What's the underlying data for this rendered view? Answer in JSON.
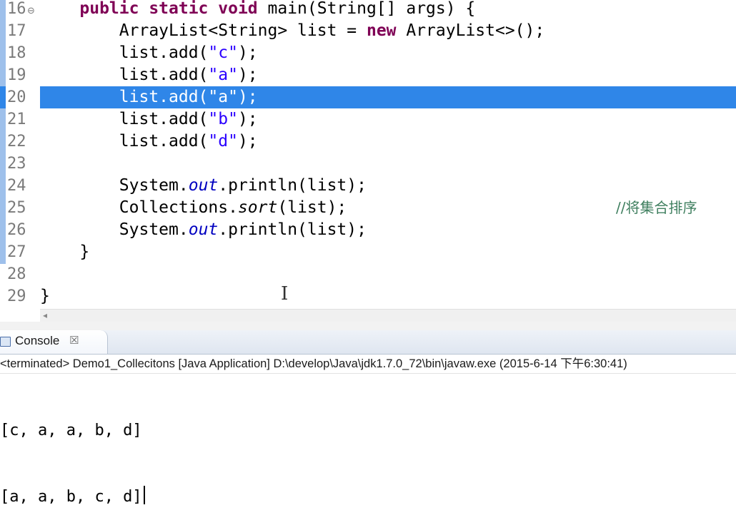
{
  "editor": {
    "lines": [
      {
        "num": "16",
        "fold": true,
        "parts": [
          [
            "",
            "    "
          ],
          [
            "kw",
            "public static void"
          ],
          [
            "",
            " main(String[] args) {"
          ]
        ]
      },
      {
        "num": "17",
        "parts": [
          [
            "",
            "        ArrayList<String> list = "
          ],
          [
            "kw",
            "new"
          ],
          [
            "",
            " ArrayList<>();"
          ]
        ]
      },
      {
        "num": "18",
        "parts": [
          [
            "",
            "        list.add("
          ],
          [
            "str",
            "\"c\""
          ],
          [
            "",
            ");"
          ]
        ]
      },
      {
        "num": "19",
        "parts": [
          [
            "",
            "        list.add("
          ],
          [
            "str",
            "\"a\""
          ],
          [
            "",
            ");"
          ]
        ]
      },
      {
        "num": "20",
        "highlight": true,
        "parts": [
          [
            "",
            "        list.add("
          ],
          [
            "str",
            "\"a\""
          ],
          [
            "",
            ");"
          ]
        ]
      },
      {
        "num": "21",
        "parts": [
          [
            "",
            "        list.add("
          ],
          [
            "str",
            "\"b\""
          ],
          [
            "",
            ");"
          ]
        ]
      },
      {
        "num": "22",
        "parts": [
          [
            "",
            "        list.add("
          ],
          [
            "str",
            "\"d\""
          ],
          [
            "",
            ");"
          ]
        ]
      },
      {
        "num": "23",
        "parts": []
      },
      {
        "num": "24",
        "parts": [
          [
            "",
            "        System."
          ],
          [
            "field",
            "out"
          ],
          [
            "",
            ".println(list);"
          ]
        ]
      },
      {
        "num": "25",
        "comment": "//将集合排序",
        "parts": [
          [
            "",
            "        Collections."
          ],
          [
            "static-m",
            "sort"
          ],
          [
            "",
            "(list);"
          ]
        ]
      },
      {
        "num": "26",
        "parts": [
          [
            "",
            "        System."
          ],
          [
            "field",
            "out"
          ],
          [
            "",
            ".println(list);"
          ]
        ]
      },
      {
        "num": "27",
        "parts": [
          [
            "",
            "    }"
          ]
        ]
      },
      {
        "num": "28",
        "parts": []
      },
      {
        "num": "29",
        "parts": [
          [
            "",
            "}"
          ]
        ]
      }
    ]
  },
  "console": {
    "tab_label": "Console",
    "close_symbol": "☒",
    "status": "<terminated> Demo1_Collecitons [Java Application] D:\\develop\\Java\\jdk1.7.0_72\\bin\\javaw.exe (2015-6-14 下午6:30:41)",
    "output": [
      "[c, a, a, b, d]",
      "[a, a, b, c, d]"
    ]
  },
  "icons": {
    "fold": "collapse-fold-icon",
    "cursor": "ibeam-cursor-icon",
    "scroll_left": "scroll-left-arrow-icon"
  }
}
